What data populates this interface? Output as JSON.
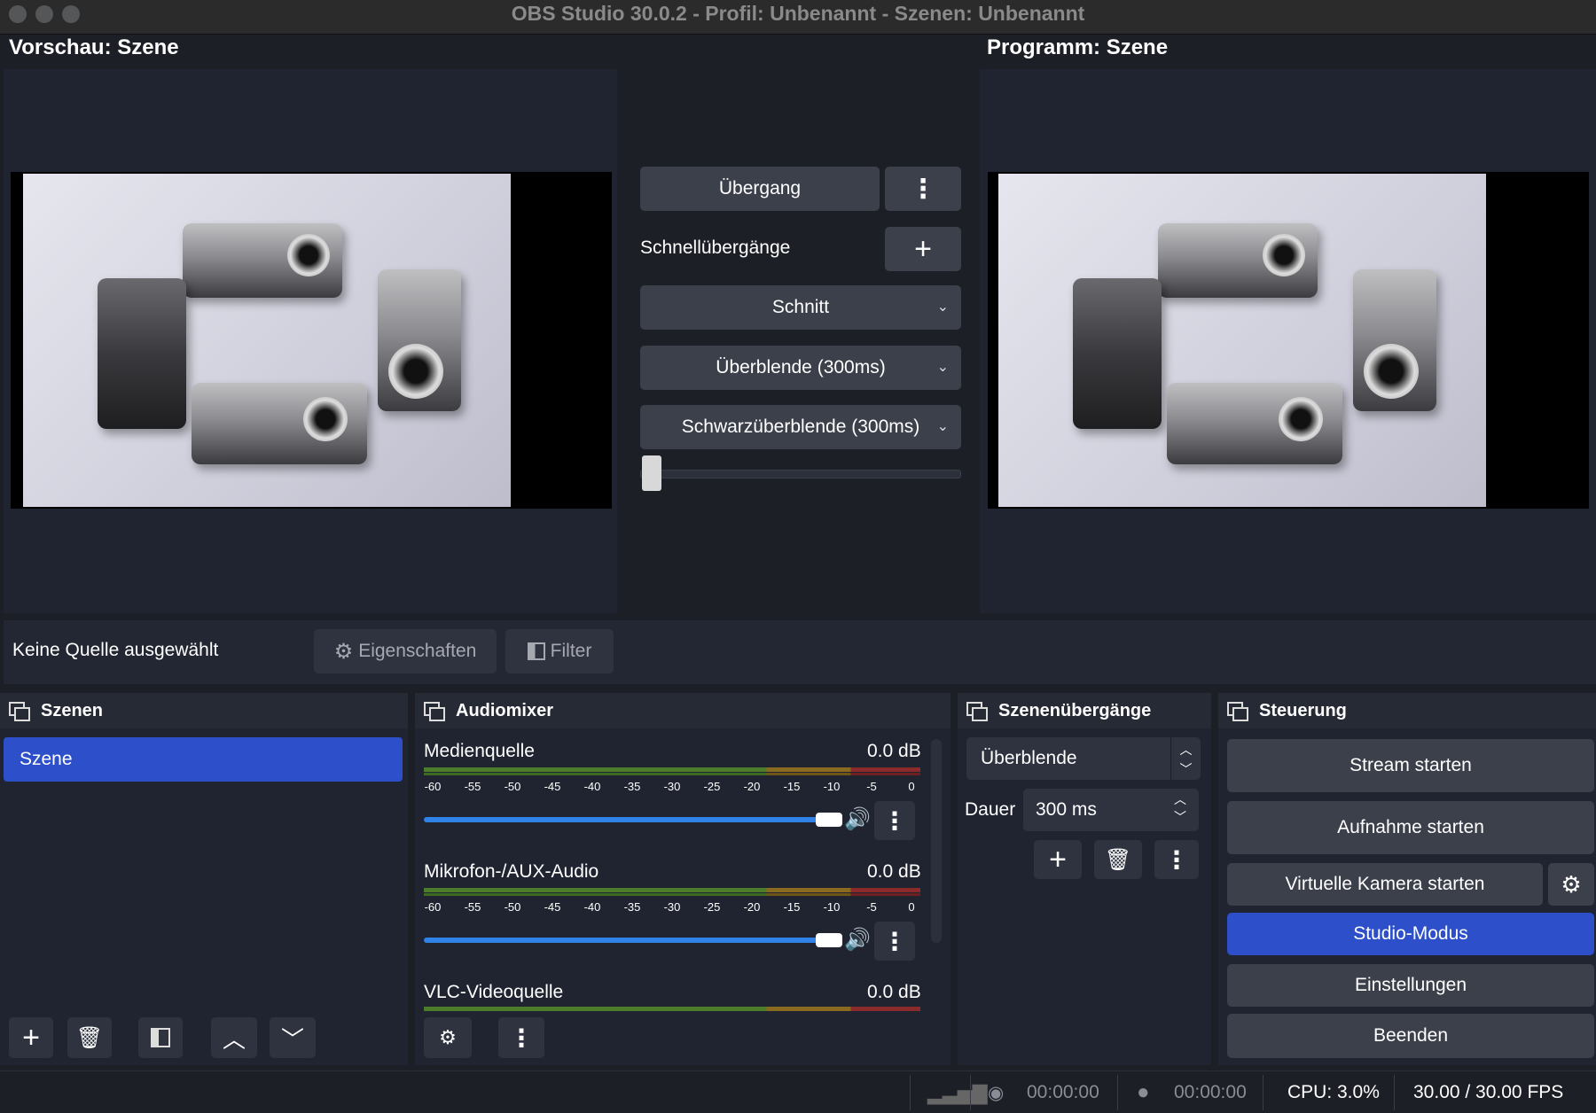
{
  "window": {
    "title": "OBS Studio 30.0.2 - Profil: Unbenannt - Szenen: Unbenannt"
  },
  "preview": {
    "title": "Vorschau: Szene"
  },
  "program": {
    "title": "Programm: Szene"
  },
  "transition": {
    "button_label": "Übergang",
    "quick_label": "Schnellübergänge",
    "quick_items": [
      "Schnitt",
      "Überblende (300ms)",
      "Schwarzüberblende (300ms)"
    ],
    "tbar_value": 0
  },
  "source_bar": {
    "no_source": "Keine Quelle ausgewählt",
    "properties_label": "Eigenschaften",
    "filter_label": "Filter"
  },
  "scenes": {
    "header": "Szenen",
    "items": [
      "Szene"
    ]
  },
  "audiomixer": {
    "header": "Audiomixer",
    "ticks": [
      "-60",
      "-55",
      "-50",
      "-45",
      "-40",
      "-35",
      "-30",
      "-25",
      "-20",
      "-15",
      "-10",
      "-5",
      "0"
    ],
    "channels": [
      {
        "name": "Medienquelle",
        "level": "0.0 dB",
        "volume": 1.0
      },
      {
        "name": "Mikrofon-/AUX-Audio",
        "level": "0.0 dB",
        "volume": 1.0
      },
      {
        "name": "VLC-Videoquelle",
        "level": "0.0 dB",
        "volume": 1.0
      }
    ]
  },
  "scene_transitions": {
    "header": "Szenenübergänge",
    "selected": "Überblende",
    "duration_label": "Dauer",
    "duration_value": "300 ms"
  },
  "controls": {
    "header": "Steuerung",
    "stream": "Stream starten",
    "record": "Aufnahme starten",
    "virtualcam": "Virtuelle Kamera starten",
    "studio": "Studio-Modus",
    "settings": "Einstellungen",
    "exit": "Beenden"
  },
  "status": {
    "stream_time": "00:00:00",
    "record_time": "00:00:00",
    "cpu": "CPU: 3.0%",
    "fps": "30.00 / 30.00 FPS"
  },
  "colors": {
    "accent": "#2d4fc9",
    "button": "#3c404b",
    "panel": "#202430",
    "background": "#1d1f26"
  }
}
